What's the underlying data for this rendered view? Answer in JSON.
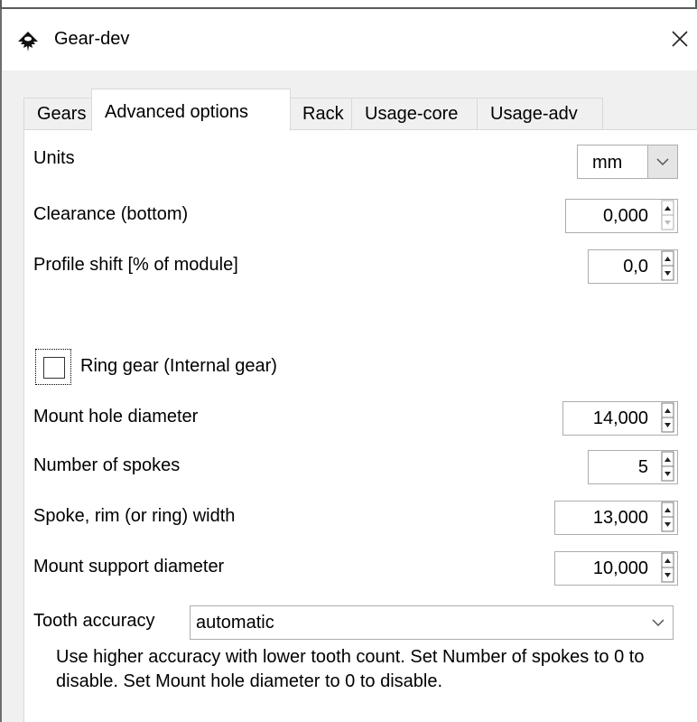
{
  "window": {
    "title": "Gear-dev",
    "icon": "inkscape-icon",
    "close_icon": "close-icon"
  },
  "tabs": [
    {
      "label": "Gears",
      "active": false
    },
    {
      "label": "Advanced options",
      "active": true
    },
    {
      "label": "Rack",
      "active": false
    },
    {
      "label": "Usage-core",
      "active": false
    },
    {
      "label": "Usage-adv",
      "active": false
    }
  ],
  "fields": {
    "units": {
      "label": "Units",
      "value": "mm"
    },
    "clearance": {
      "label": "Clearance (bottom)",
      "value": "0,000"
    },
    "profile_shift": {
      "label": "Profile shift [% of module]",
      "value": "0,0"
    },
    "ring_gear": {
      "label": "Ring gear (Internal gear)",
      "checked": false
    },
    "mount_hole": {
      "label": "Mount hole diameter",
      "value": "14,000"
    },
    "spokes": {
      "label": "Number of spokes",
      "value": "5"
    },
    "spoke_width": {
      "label": "Spoke, rim (or ring) width",
      "value": "13,000"
    },
    "mount_support": {
      "label": "Mount support diameter",
      "value": "10,000"
    },
    "tooth_accuracy": {
      "label": "Tooth accuracy",
      "value": "automatic"
    }
  },
  "note": "Use higher accuracy with lower tooth count. Set Number of spokes to 0 to disable. Set Mount hole diameter to 0 to disable.",
  "colors": {
    "panel_bg": "#ffffff",
    "window_bg": "#f0f0f0",
    "border": "#adadad"
  }
}
